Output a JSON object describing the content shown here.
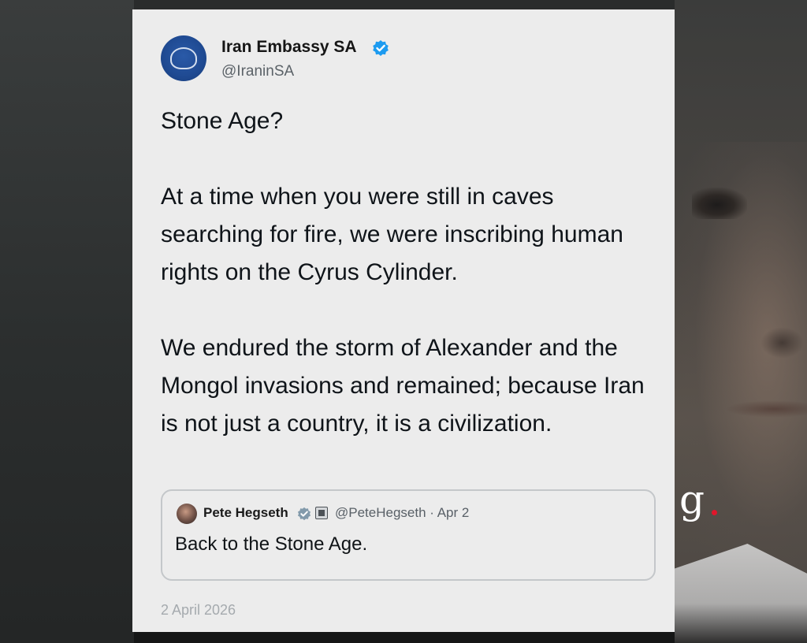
{
  "tweet": {
    "author_name": "Iran Embassy SA",
    "author_handle": "@IraninSA",
    "verified_color": "#1d9bf0",
    "paragraphs": [
      "Stone Age?",
      "At a time when you were still in caves searching for fire, we were inscribing human rights on the Cyrus Cylinder.",
      "We endured the storm of Alexander and the Mongol invasions and remained; because Iran is not just a country, it is a civilization."
    ],
    "date": "2 April 2026"
  },
  "quoted_tweet": {
    "author_name": "Pete Hegseth",
    "meta": "@PeteHegseth · Apr 2",
    "text": "Back to the Stone Age.",
    "verified_color": "#829aab"
  },
  "overlay": {
    "logo_letter": "g",
    "logo_dot_color": "#e0162b"
  }
}
